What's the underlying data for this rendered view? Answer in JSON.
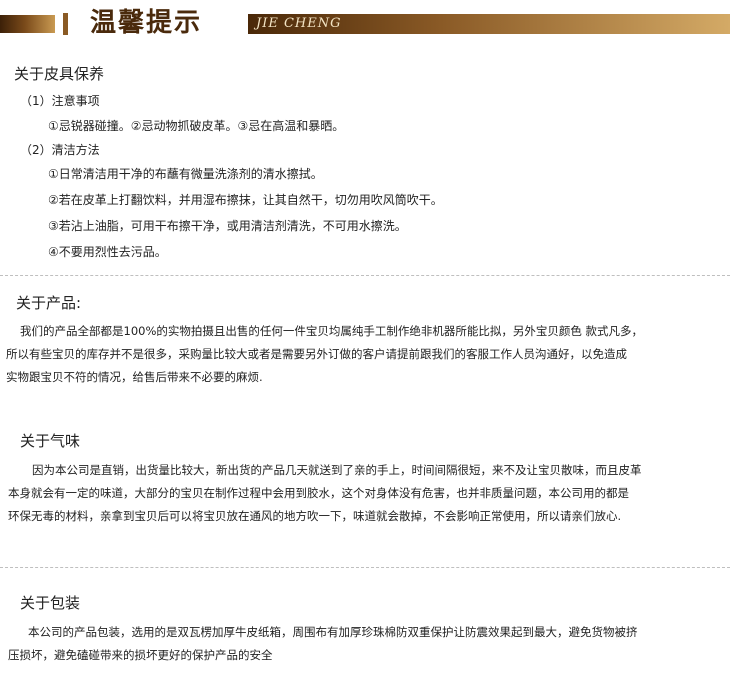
{
  "header": {
    "title": "温馨提示",
    "subtitle_en": "JIE CHENG"
  },
  "care": {
    "title": "关于皮具保养",
    "sub1": "（1）注意事项",
    "item1": "①忌锐器碰撞。②忌动物抓破皮革。③忌在高温和暴晒。",
    "sub2": "（2）清洁方法",
    "steps": [
      "①日常清洁用干净的布蘸有微量洗涤剂的清水擦拭。",
      "②若在皮革上打翻饮料，并用湿布擦抹，让其自然干，切勿用吹风筒吹干。",
      "③若沾上油脂，可用干布擦干净，或用清洁剂清洗，不可用水擦洗。",
      "④不要用烈性去污品。"
    ]
  },
  "product": {
    "title": "关于产品:",
    "lines": [
      "我们的产品全部都是100%的实物拍摄且出售的任何一件宝贝均属纯手工制作绝非机器所能比拟，另外宝贝颜色 款式凡多，",
      "所以有些宝贝的库存并不是很多，采购量比较大或者是需要另外订做的客户请提前跟我们的客服工作人员沟通好，以免造成",
      "实物跟宝贝不符的情况，给售后带来不必要的麻烦."
    ]
  },
  "smell": {
    "title": "关于气味",
    "lines": [
      "因为本公司是直销，出货量比较大，新出货的产品几天就送到了亲的手上，时间间隔很短，来不及让宝贝散味，而且皮革",
      "本身就会有一定的味道，大部分的宝贝在制作过程中会用到胶水，这个对身体没有危害，也并非质量问题，本公司用的都是",
      "环保无毒的材料，亲拿到宝贝后可以将宝贝放在通风的地方吹一下，味道就会散掉，不会影响正常使用，所以请亲们放心."
    ]
  },
  "packaging": {
    "title": "关于包装",
    "lines": [
      "本公司的产品包装，选用的是双瓦楞加厚牛皮纸箱，周围布有加厚珍珠棉防双重保护让防震效果起到最大，避免货物被挤",
      "压损坏，避免磕碰带来的损坏更好的保护产品的安全"
    ]
  }
}
